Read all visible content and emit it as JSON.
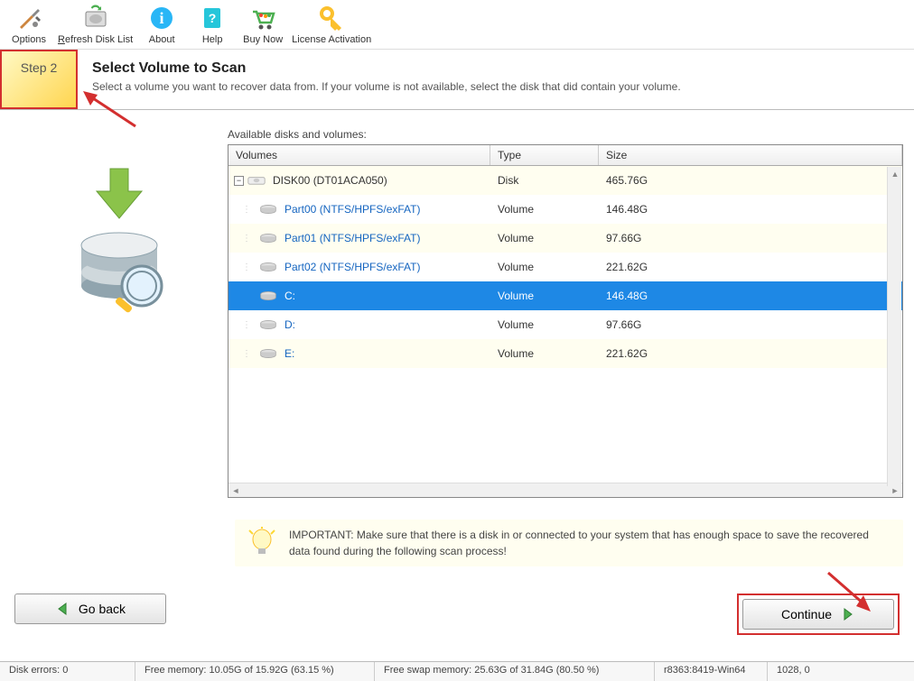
{
  "toolbar": {
    "options": "Options",
    "refresh": "Refresh Disk List",
    "about": "About",
    "help": "Help",
    "buynow": "Buy Now",
    "license": "License Activation"
  },
  "step": {
    "badge": "Step 2",
    "title": "Select Volume to Scan",
    "desc": "Select a volume you want to recover data from. If your volume is not available, select the disk that did contain your volume."
  },
  "table": {
    "label": "Available disks and volumes:",
    "headers": {
      "name": "Volumes",
      "type": "Type",
      "size": "Size"
    },
    "rows": [
      {
        "kind": "disk",
        "name": "DISK00 (DT01ACA050)",
        "type": "Disk",
        "size": "465.76G"
      },
      {
        "kind": "vol",
        "name": "Part00 (NTFS/HPFS/exFAT)",
        "type": "Volume",
        "size": "146.48G"
      },
      {
        "kind": "vol",
        "name": "Part01 (NTFS/HPFS/exFAT)",
        "type": "Volume",
        "size": "97.66G"
      },
      {
        "kind": "vol",
        "name": "Part02 (NTFS/HPFS/exFAT)",
        "type": "Volume",
        "size": "221.62G"
      },
      {
        "kind": "vol-sel",
        "name": "C:",
        "type": "Volume",
        "size": "146.48G"
      },
      {
        "kind": "vol",
        "name": "D:",
        "type": "Volume",
        "size": "97.66G"
      },
      {
        "kind": "vol",
        "name": "E:",
        "type": "Volume",
        "size": "221.62G"
      }
    ]
  },
  "info": "IMPORTANT: Make sure that there is a disk in or connected to your system that has enough space to save the recovered data found during the following scan process!",
  "buttons": {
    "back": "Go back",
    "continue": "Continue"
  },
  "status": {
    "diskerrors": "Disk errors: 0",
    "freemem": "Free memory: 10.05G of 15.92G (63.15 %)",
    "freeswap": "Free swap memory: 25.63G of 31.84G (80.50 %)",
    "build": "r8363:8419-Win64",
    "coords": "1028, 0"
  }
}
